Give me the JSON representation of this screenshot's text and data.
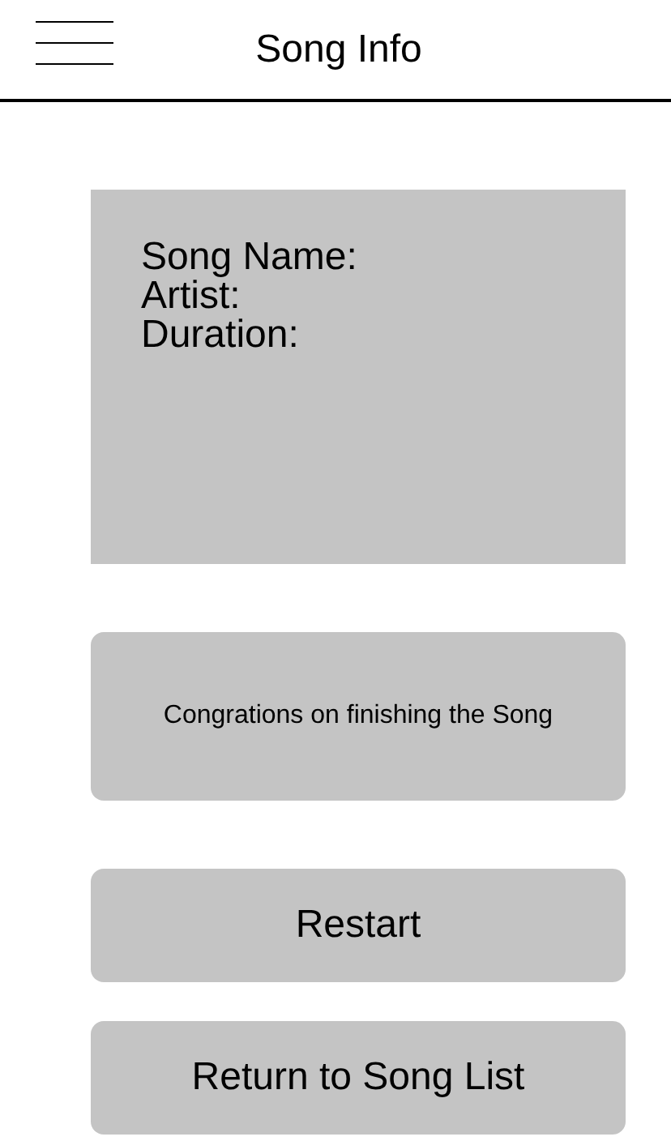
{
  "header": {
    "title": "Song Info"
  },
  "info_panel": {
    "lines": [
      "Song Name:",
      "Artist:",
      "Duration:"
    ]
  },
  "message": "Congrations on finishing the Song",
  "buttons": [
    "Restart",
    "Return to Song List"
  ]
}
